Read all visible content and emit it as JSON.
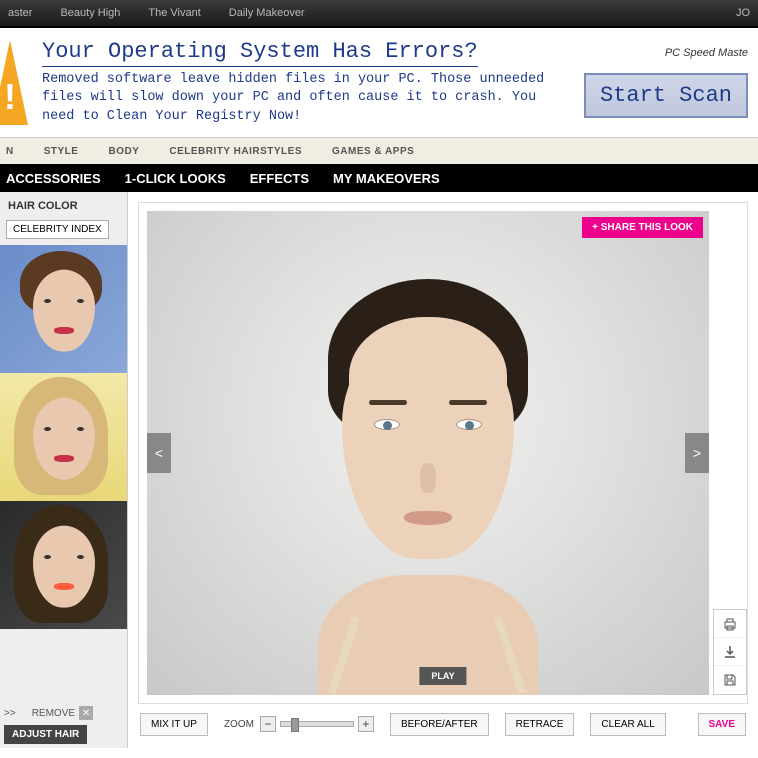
{
  "topnav": {
    "items": [
      "aster",
      "Beauty High",
      "The Vivant",
      "Daily Makeover"
    ],
    "right": "JO"
  },
  "ad": {
    "headline": "Your Operating System Has Errors?",
    "body": "Removed software leave hidden files in your PC. Those unneeded files will slow down your PC and often cause it to crash. You need to Clean Your Registry Now!",
    "site": "PC Speed Maste",
    "scan": "Start Scan"
  },
  "subnav1": {
    "items": [
      "N",
      "STYLE",
      "BODY",
      "CELEBRITY HAIRSTYLES",
      "GAMES & APPS"
    ]
  },
  "subnav2": {
    "items": [
      "ACCESSORIES",
      "1-CLICK LOOKS",
      "EFFECTS",
      "MY MAKEOVERS"
    ]
  },
  "sidebar": {
    "header": "HAIR COLOR",
    "celeb_index": "CELEBRITY INDEX",
    "remove_prefix": ">>",
    "remove_label": "REMOVE",
    "adjust_hair": "ADJUST HAIR"
  },
  "canvas": {
    "share": "+ SHARE THIS LOOK",
    "prev": "<",
    "next": ">",
    "play": "PLAY"
  },
  "controls": {
    "mix": "MIX IT UP",
    "zoom_label": "ZOOM",
    "minus": "−",
    "plus": "+",
    "before_after": "BEFORE/AFTER",
    "retrace": "RETRACE",
    "clear_all": "CLEAR ALL",
    "save": "SAVE"
  }
}
